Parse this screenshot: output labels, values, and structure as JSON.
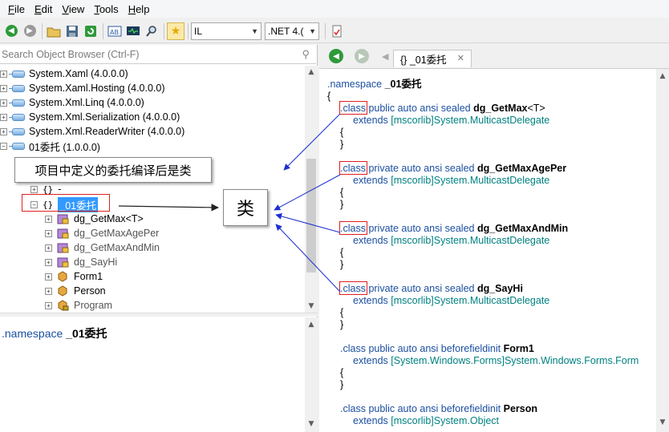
{
  "menu": {
    "file_key": "F",
    "file_rest": "ile",
    "edit_key": "E",
    "edit_rest": "dit",
    "view_key": "V",
    "view_rest": "iew",
    "tools_key": "T",
    "tools_rest": "ools",
    "help_key": "H",
    "help_rest": "elp"
  },
  "toolbar": {
    "language": "IL",
    "framework": ".NET 4.("
  },
  "search": {
    "placeholder": "Search Object Browser (Ctrl-F)"
  },
  "tree": {
    "assemblies": [
      "System.Xaml (4.0.0.0)",
      "System.Xaml.Hosting (4.0.0.0)",
      "System.Xml.Linq (4.0.0.0)",
      "System.Xml.Serialization (4.0.0.0)",
      "System.Xml.ReaderWriter (4.0.0.0)",
      "01委托 (1.0.0.0)"
    ],
    "ns_dash_brace": "{}",
    "ns_dash": "-",
    "ns_selected_brace": "{}",
    "ns_selected": "_01委托",
    "types": [
      "dg_GetMax<T>",
      "dg_GetMaxAgePer",
      "dg_GetMaxAndMin",
      "dg_SayHi",
      "Form1",
      "Person",
      "Program"
    ]
  },
  "summary": {
    "keyword": ".namespace",
    "name": "_01委托"
  },
  "tab": {
    "label": "{} _01委托",
    "close": "✕"
  },
  "code": {
    "ns_kw": ".namespace",
    "ns_name": "_01委托",
    "open": "{",
    "close": "}",
    "class_kw": ".class",
    "extends_kw": "extends",
    "classes": [
      {
        "mods": "public auto ansi sealed",
        "name": "dg_GetMax",
        "generic": "<T>",
        "asm": "[mscorlib]",
        "base": "System.MulticastDelegate"
      },
      {
        "mods": "private auto ansi sealed",
        "name": "dg_GetMaxAgePer",
        "generic": "",
        "asm": "[mscorlib]",
        "base": "System.MulticastDelegate"
      },
      {
        "mods": "private auto ansi sealed",
        "name": "dg_GetMaxAndMin",
        "generic": "",
        "asm": "[mscorlib]",
        "base": "System.MulticastDelegate"
      },
      {
        "mods": "private auto ansi sealed",
        "name": "dg_SayHi",
        "generic": "",
        "asm": "[mscorlib]",
        "base": "System.MulticastDelegate"
      },
      {
        "mods": "public auto ansi beforefieldinit",
        "name": "Form1",
        "generic": "",
        "asm": "[System.Windows.Forms]",
        "base": "System.Windows.Forms.Form"
      },
      {
        "mods": "public auto ansi beforefieldinit",
        "name": "Person",
        "generic": "",
        "asm": "[mscorlib]",
        "base": "System.Object"
      }
    ]
  },
  "annotations": {
    "callout_text": "项目中定义的委托编译后是类",
    "class_label": "类"
  },
  "colors": {
    "accent": "#1b4fa0",
    "highlight": "#3399ff",
    "annotation_red": "#e02020",
    "arrow_blue": "#1a2fd0"
  }
}
